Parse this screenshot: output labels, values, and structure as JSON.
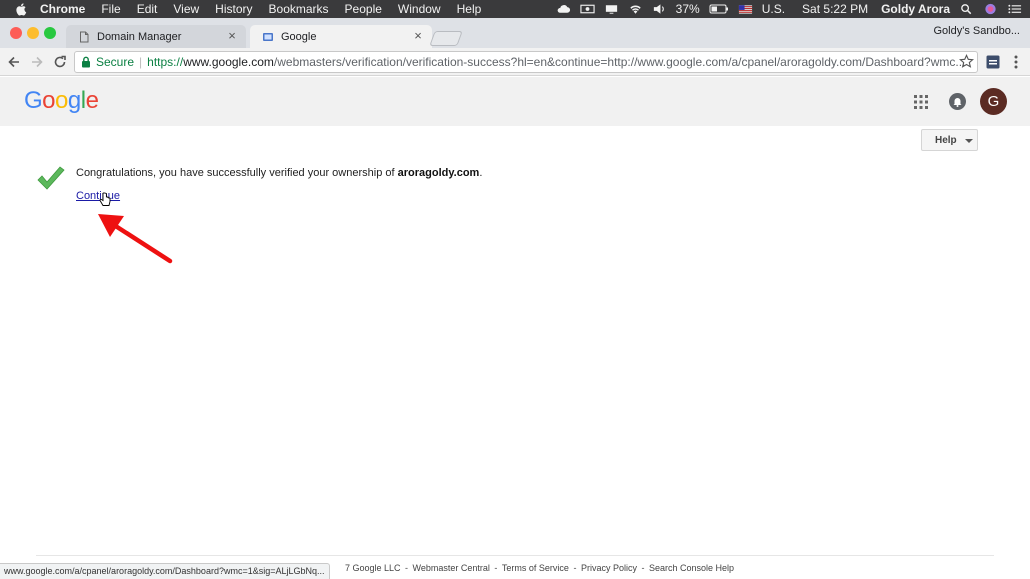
{
  "menubar": {
    "app": "Chrome",
    "items": [
      "File",
      "Edit",
      "View",
      "History",
      "Bookmarks",
      "People",
      "Window",
      "Help"
    ],
    "battery": "37%",
    "input_source": "U.S.",
    "clock": "Sat 5:22 PM",
    "user": "Goldy Arora"
  },
  "tabs": [
    {
      "label": "Domain Manager"
    },
    {
      "label": "Google"
    }
  ],
  "profile": "Goldy's Sandbo...",
  "address": {
    "security_label": "Secure",
    "scheme": "https://",
    "host": "www.google.com",
    "path": "/webmasters/verification/verification-success?hl=en&continue=http://www.google.com/a/cpanel/aroragoldy.com/Dashboard?wmc..."
  },
  "header": {
    "logo": "Google",
    "avatar_initial": "G",
    "logo_colors": [
      "#4285F4",
      "#EA4335",
      "#FBBC05",
      "#4285F4",
      "#34A853",
      "#EA4335"
    ]
  },
  "help_button": "Help",
  "content": {
    "message": "Congratulations, you have successfully verified your ownership of ",
    "domain": "aroragoldy.com",
    "period": ".",
    "continue_link": "Continue"
  },
  "footer": {
    "copyright": "7 Google LLC",
    "links": [
      "Webmaster Central",
      "Terms of Service",
      "Privacy Policy",
      "Search Console Help"
    ],
    "separator": " - "
  },
  "status_url": "www.google.com/a/cpanel/aroragoldy.com/Dashboard?wmc=1&sig=ALjLGbNq..."
}
